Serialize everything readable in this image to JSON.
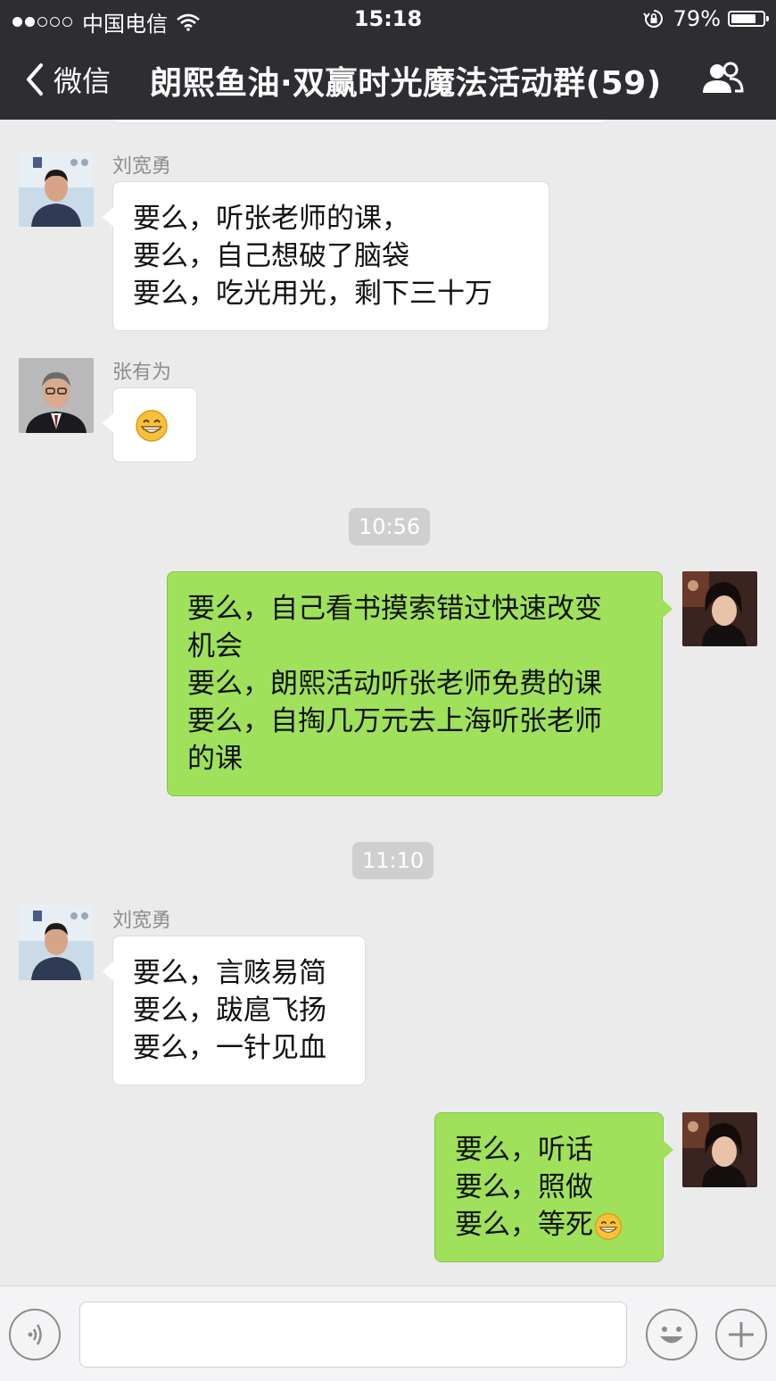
{
  "status_bar": {
    "carrier": "中国电信",
    "time": "15:18",
    "battery": "79%",
    "battery_level": 0.79,
    "signal_bars": 2
  },
  "nav": {
    "back_label": "微信",
    "title": "朗熙鱼油·双赢时光魔法活动群(59)"
  },
  "messages": [
    {
      "sender": "刘宽勇",
      "lines": [
        "要么，听张老师的课，",
        "要么，自己想破了脑袋",
        "要么，吃光用光，剩下三十万"
      ]
    },
    {
      "sender": "张有为"
    },
    {
      "time": "10:56"
    },
    {
      "lines": [
        "要么，自己看书摸索错过快速改变",
        "机会",
        "要么，朗熙活动听张老师免费的课",
        "要么，自掏几万元去上海听张老师",
        "的课"
      ]
    },
    {
      "time": "11:10"
    },
    {
      "sender": "刘宽勇",
      "lines": [
        "要么，言赅易简",
        "要么，跋扈飞扬",
        "要么，一针见血"
      ]
    },
    {
      "lines": [
        "要么，听话",
        "要么，照做",
        "要么，等死"
      ]
    }
  ],
  "colors": {
    "nav_bg": "#2e2d32",
    "chat_bg": "#ebebeb",
    "outgoing_bubble": "#9fe15a",
    "incoming_bubble": "#ffffff"
  }
}
